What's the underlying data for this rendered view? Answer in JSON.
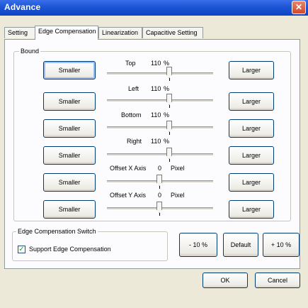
{
  "window": {
    "title": "Advance",
    "close_glyph": "✕"
  },
  "tabs": [
    {
      "label": "Setting"
    },
    {
      "label": "Edge Compensation",
      "active": true
    },
    {
      "label": "Linearization"
    },
    {
      "label": "Capacitive Setting"
    }
  ],
  "bound": {
    "group_label": "Bound",
    "rows": [
      {
        "smaller": "Smaller",
        "larger": "Larger",
        "label": "Top",
        "value": "110",
        "unit": "%"
      },
      {
        "smaller": "Smaller",
        "larger": "Larger",
        "label": "Left",
        "value": "110",
        "unit": "%"
      },
      {
        "smaller": "Smaller",
        "larger": "Larger",
        "label": "Bottom",
        "value": "110",
        "unit": "%"
      },
      {
        "smaller": "Smaller",
        "larger": "Larger",
        "label": "Right",
        "value": "110",
        "unit": "%"
      },
      {
        "smaller": "Smaller",
        "larger": "Larger",
        "label": "Offset X Axis",
        "value": "0",
        "unit": "Pixel"
      },
      {
        "smaller": "Smaller",
        "larger": "Larger",
        "label": "Offset Y Axis",
        "value": "0",
        "unit": "Pixel"
      }
    ]
  },
  "switch": {
    "group_label": "Edge Compensation Switch",
    "checkbox_label": "Support Edge Compensation",
    "checked": true,
    "check_glyph": "✓"
  },
  "actions": {
    "minus": "- 10 %",
    "default": "Default",
    "plus": "+ 10 %"
  },
  "footer": {
    "ok": "OK",
    "cancel": "Cancel"
  }
}
